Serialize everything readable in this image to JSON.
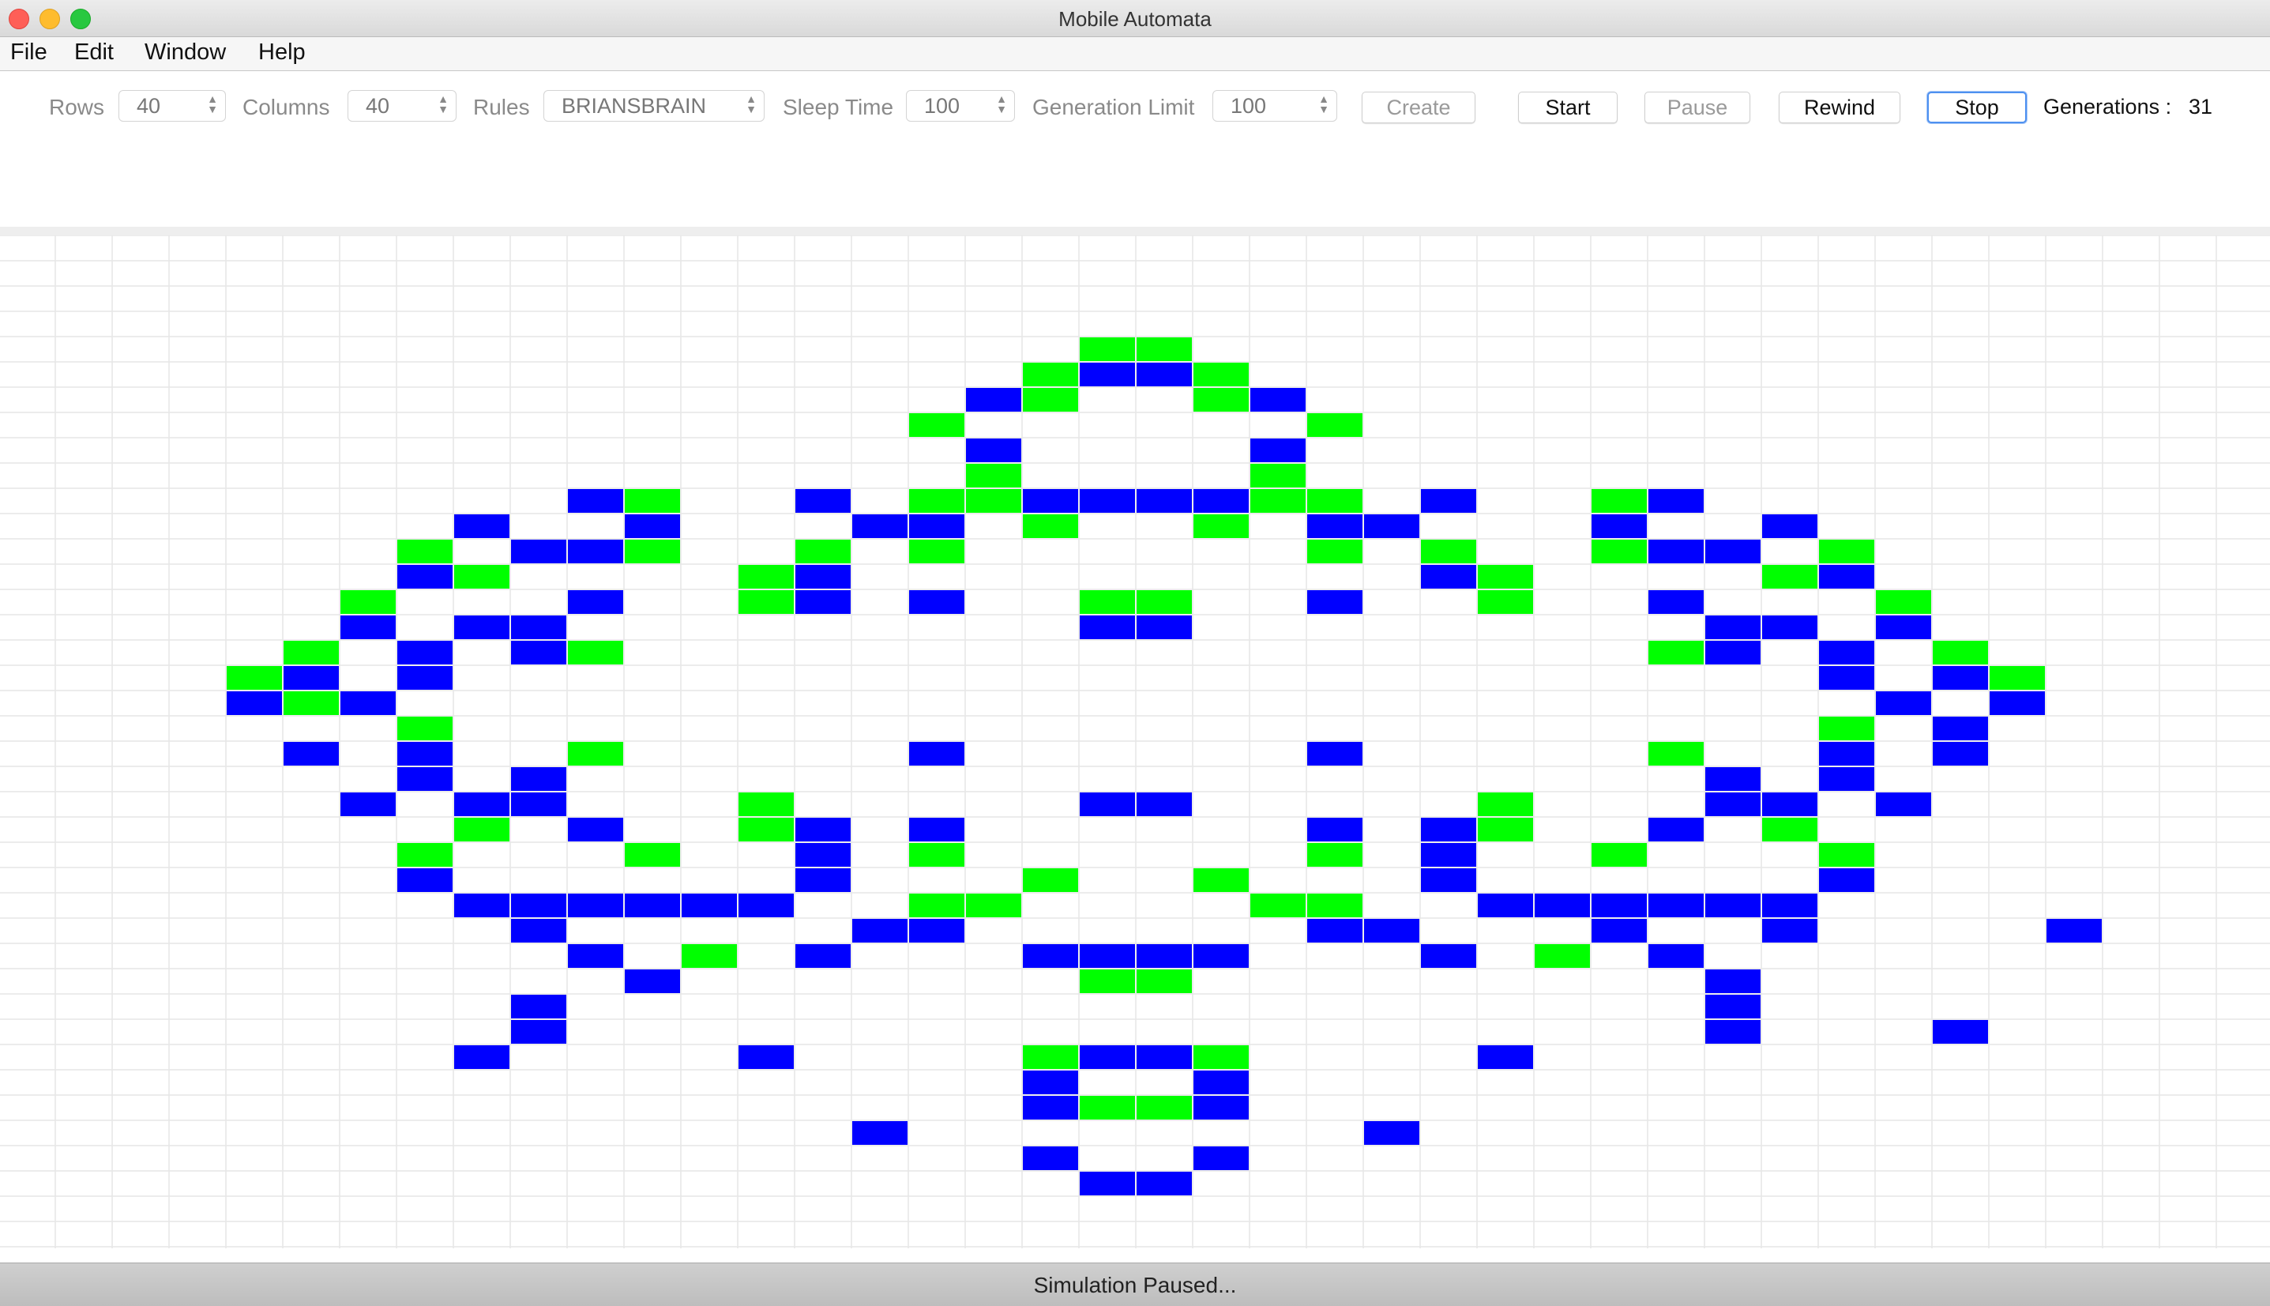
{
  "window": {
    "title": "Mobile Automata"
  },
  "menu": [
    "File",
    "Edit",
    "Window",
    "Help"
  ],
  "toolbar": {
    "rows_label": "Rows",
    "rows_value": "40",
    "columns_label": "Columns",
    "columns_value": "40",
    "rules_label": "Rules",
    "rules_value": "BRIANSBRAIN",
    "sleep_label": "Sleep Time",
    "sleep_value": "100",
    "genlimit_label": "Generation Limit",
    "genlimit_value": "100",
    "create_label": "Create",
    "start_label": "Start",
    "pause_label": "Pause",
    "rewind_label": "Rewind",
    "stop_label": "Stop",
    "generations_label": "Generations :",
    "generations_value": "31"
  },
  "grid": {
    "colors": {
      "on": "#00ff00",
      "dying": "#0000ff",
      "off": "#ffffff",
      "line": "#e6e6e6"
    },
    "cells": {
      "on": [
        [
          4,
          19
        ],
        [
          4,
          20
        ],
        [
          5,
          18
        ],
        [
          5,
          21
        ],
        [
          6,
          18
        ],
        [
          6,
          21
        ],
        [
          7,
          16
        ],
        [
          7,
          23
        ],
        [
          9,
          17
        ],
        [
          9,
          22
        ],
        [
          10,
          11
        ],
        [
          10,
          16
        ],
        [
          10,
          17
        ],
        [
          10,
          22
        ],
        [
          10,
          23
        ],
        [
          10,
          28
        ],
        [
          11,
          18
        ],
        [
          11,
          21
        ],
        [
          12,
          7
        ],
        [
          12,
          11
        ],
        [
          12,
          14
        ],
        [
          12,
          16
        ],
        [
          12,
          23
        ],
        [
          12,
          25
        ],
        [
          12,
          28
        ],
        [
          12,
          32
        ],
        [
          13,
          8
        ],
        [
          13,
          13
        ],
        [
          13,
          26
        ],
        [
          13,
          31
        ],
        [
          14,
          6
        ],
        [
          14,
          13
        ],
        [
          14,
          19
        ],
        [
          14,
          20
        ],
        [
          14,
          26
        ],
        [
          14,
          33
        ],
        [
          16,
          5
        ],
        [
          16,
          10
        ],
        [
          16,
          29
        ],
        [
          16,
          34
        ],
        [
          17,
          4
        ],
        [
          17,
          7
        ],
        [
          17,
          32
        ],
        [
          17,
          35
        ],
        [
          18,
          5
        ],
        [
          18,
          35
        ],
        [
          19,
          7
        ],
        [
          19,
          32
        ],
        [
          20,
          5
        ],
        [
          20,
          10
        ],
        [
          20,
          29
        ],
        [
          20,
          34
        ],
        [
          22,
          6
        ],
        [
          22,
          13
        ],
        [
          22,
          19
        ],
        [
          22,
          20
        ],
        [
          22,
          26
        ],
        [
          22,
          33
        ],
        [
          23,
          8
        ],
        [
          23,
          13
        ],
        [
          23,
          26
        ],
        [
          23,
          31
        ],
        [
          24,
          7
        ],
        [
          24,
          11
        ],
        [
          24,
          14
        ],
        [
          24,
          16
        ],
        [
          24,
          23
        ],
        [
          24,
          25
        ],
        [
          24,
          28
        ],
        [
          24,
          32
        ],
        [
          25,
          18
        ],
        [
          25,
          21
        ],
        [
          26,
          8
        ],
        [
          26,
          12
        ],
        [
          26,
          16
        ],
        [
          26,
          17
        ],
        [
          26,
          22
        ],
        [
          26,
          23
        ],
        [
          26,
          27
        ],
        [
          26,
          31
        ],
        [
          28,
          12
        ],
        [
          28,
          27
        ],
        [
          29,
          19
        ],
        [
          29,
          20
        ],
        [
          32,
          18
        ],
        [
          32,
          21
        ],
        [
          34,
          19
        ],
        [
          34,
          20
        ]
      ],
      "dying": [
        [
          5,
          19
        ],
        [
          5,
          20
        ],
        [
          6,
          17
        ],
        [
          6,
          22
        ],
        [
          8,
          17
        ],
        [
          8,
          22
        ],
        [
          10,
          10
        ],
        [
          10,
          14
        ],
        [
          10,
          18
        ],
        [
          10,
          19
        ],
        [
          10,
          20
        ],
        [
          10,
          21
        ],
        [
          10,
          25
        ],
        [
          10,
          29
        ],
        [
          11,
          8
        ],
        [
          11,
          11
        ],
        [
          11,
          15
        ],
        [
          11,
          16
        ],
        [
          11,
          23
        ],
        [
          11,
          24
        ],
        [
          11,
          28
        ],
        [
          11,
          31
        ],
        [
          12,
          9
        ],
        [
          12,
          10
        ],
        [
          12,
          29
        ],
        [
          12,
          30
        ],
        [
          13,
          7
        ],
        [
          13,
          14
        ],
        [
          13,
          25
        ],
        [
          13,
          32
        ],
        [
          14,
          10
        ],
        [
          14,
          14
        ],
        [
          14,
          16
        ],
        [
          14,
          23
        ],
        [
          14,
          29
        ],
        [
          15,
          6
        ],
        [
          15,
          8
        ],
        [
          15,
          9
        ],
        [
          15,
          19
        ],
        [
          15,
          20
        ],
        [
          15,
          30
        ],
        [
          15,
          31
        ],
        [
          15,
          33
        ],
        [
          16,
          7
        ],
        [
          16,
          9
        ],
        [
          16,
          30
        ],
        [
          16,
          32
        ],
        [
          17,
          5
        ],
        [
          17,
          7
        ],
        [
          17,
          32
        ],
        [
          17,
          34
        ],
        [
          18,
          4
        ],
        [
          18,
          6
        ],
        [
          18,
          33
        ],
        [
          18,
          35
        ],
        [
          19,
          34
        ],
        [
          20,
          5
        ],
        [
          20,
          7
        ],
        [
          20,
          16
        ],
        [
          20,
          23
        ],
        [
          20,
          32
        ],
        [
          20,
          34
        ],
        [
          21,
          7
        ],
        [
          21,
          9
        ],
        [
          21,
          30
        ],
        [
          21,
          32
        ],
        [
          22,
          6
        ],
        [
          22,
          8
        ],
        [
          22,
          9
        ],
        [
          22,
          19
        ],
        [
          22,
          20
        ],
        [
          22,
          30
        ],
        [
          22,
          31
        ],
        [
          22,
          33
        ],
        [
          23,
          10
        ],
        [
          23,
          14
        ],
        [
          23,
          16
        ],
        [
          23,
          23
        ],
        [
          23,
          25
        ],
        [
          23,
          29
        ],
        [
          24,
          14
        ],
        [
          24,
          25
        ],
        [
          25,
          7
        ],
        [
          25,
          14
        ],
        [
          25,
          25
        ],
        [
          25,
          32
        ],
        [
          26,
          8
        ],
        [
          26,
          9
        ],
        [
          26,
          10
        ],
        [
          26,
          11
        ],
        [
          26,
          12
        ],
        [
          26,
          13
        ],
        [
          26,
          26
        ],
        [
          26,
          27
        ],
        [
          26,
          28
        ],
        [
          26,
          29
        ],
        [
          26,
          30
        ],
        [
          26,
          31
        ],
        [
          27,
          9
        ],
        [
          27,
          15
        ],
        [
          27,
          16
        ],
        [
          27,
          23
        ],
        [
          27,
          24
        ],
        [
          27,
          28
        ],
        [
          27,
          31
        ],
        [
          27,
          36
        ],
        [
          28,
          10
        ],
        [
          28,
          14
        ],
        [
          28,
          18
        ],
        [
          28,
          19
        ],
        [
          28,
          20
        ],
        [
          28,
          21
        ],
        [
          28,
          25
        ],
        [
          28,
          29
        ],
        [
          29,
          11
        ],
        [
          29,
          30
        ],
        [
          30,
          9
        ],
        [
          30,
          30
        ],
        [
          31,
          9
        ],
        [
          31,
          30
        ],
        [
          31,
          34
        ],
        [
          32,
          8
        ],
        [
          32,
          13
        ],
        [
          32,
          19
        ],
        [
          32,
          20
        ],
        [
          32,
          26
        ],
        [
          33,
          18
        ],
        [
          33,
          21
        ],
        [
          34,
          18
        ],
        [
          34,
          21
        ],
        [
          35,
          15
        ],
        [
          35,
          24
        ],
        [
          36,
          18
        ],
        [
          36,
          21
        ],
        [
          37,
          19
        ],
        [
          37,
          20
        ]
      ]
    }
  },
  "status": {
    "text": "Simulation Paused..."
  }
}
